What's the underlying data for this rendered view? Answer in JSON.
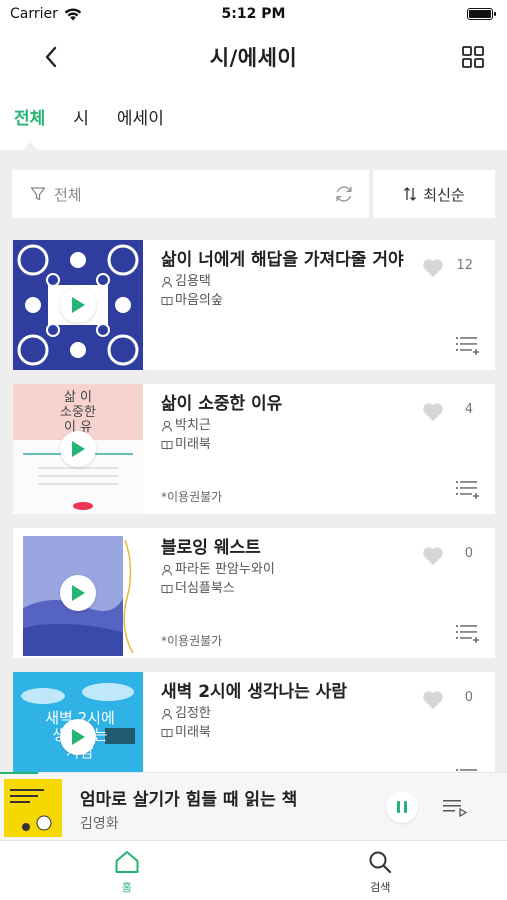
{
  "status_bar": {
    "carrier": "Carrier",
    "time": "5:12 PM"
  },
  "nav": {
    "title": "시/에세이"
  },
  "tabs": [
    {
      "label": "전체",
      "active": true
    },
    {
      "label": "시",
      "active": false
    },
    {
      "label": "에세이",
      "active": false
    }
  ],
  "filter": {
    "label": "전체",
    "sort_label": "최신순"
  },
  "books": [
    {
      "title": "삶이 너에게 해답을 가져다줄 거야",
      "author": "김용택",
      "publisher": "마음의숲",
      "likes": "12",
      "unavailable": ""
    },
    {
      "title": "삶이 소중한 이유",
      "author": "박치근",
      "publisher": "미래북",
      "likes": "4",
      "unavailable": "*이용권불가"
    },
    {
      "title": "블로잉 웨스트",
      "author": "파라돈 판암누와이",
      "publisher": "더심플북스",
      "likes": "0",
      "unavailable": "*이용권불가"
    },
    {
      "title": "새벽 2시에 생각나는 사람",
      "author": "김정한",
      "publisher": "미래북",
      "likes": "0",
      "unavailable": ""
    }
  ],
  "covers": {
    "book2_text": "삶 이\n소중한\n이 유",
    "book4_text": "새벽 2시에\n생각나는\n사람"
  },
  "player": {
    "title": "엄마로 살기가 힘들 때 읽는 책",
    "author": "김영화",
    "progress_fraction": 0.075
  },
  "bottom_tabs": [
    {
      "label": "홈",
      "icon": "home-icon",
      "active": true
    },
    {
      "label": "검색",
      "icon": "search-icon",
      "active": false
    }
  ],
  "colors": {
    "accent": "#22b573",
    "background": "#eeeeee"
  }
}
